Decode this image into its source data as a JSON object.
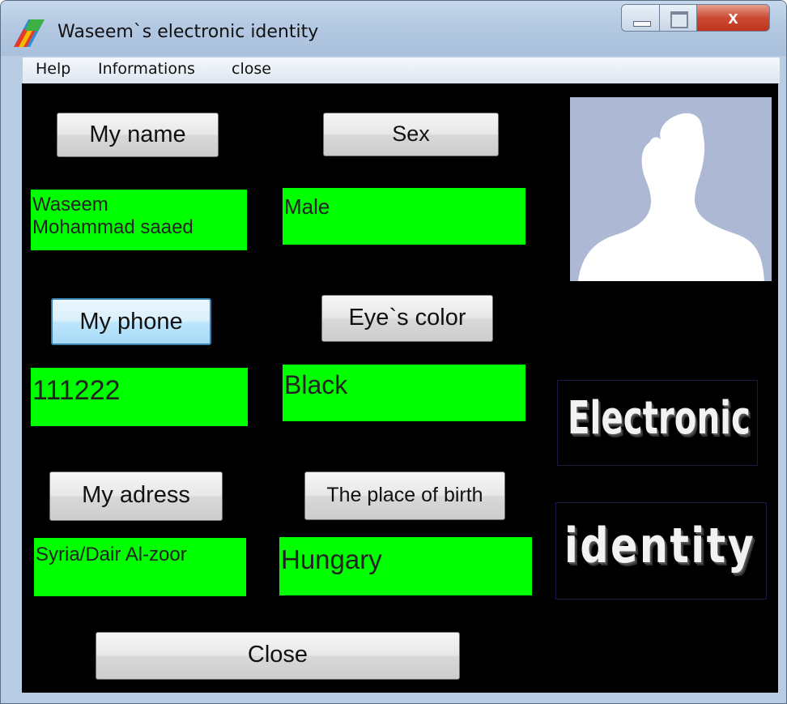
{
  "window": {
    "title": "Waseem`s electronic identity",
    "close_symbol": "x"
  },
  "menu": {
    "items": [
      "Help",
      "Informations",
      "close"
    ]
  },
  "fields": {
    "name": {
      "label": "My name",
      "value_line1": "Waseem",
      "value_line2": "Mohammad saaed"
    },
    "sex": {
      "label": "Sex",
      "value": "Male"
    },
    "phone": {
      "label": "My phone",
      "value": "111222"
    },
    "eye_color": {
      "label": "Eye`s color",
      "value": "Black"
    },
    "address": {
      "label": "My adress",
      "value": "Syria/Dair Al-zoor"
    },
    "birthplace": {
      "label": "The place of birth",
      "value": "Hungary"
    }
  },
  "close_button": {
    "label": "Close"
  },
  "logo": {
    "line1": "Electronic",
    "line2": "identity"
  },
  "colors": {
    "field_background": "#00ff00",
    "content_background": "#000000",
    "photo_background": "#adb8d5"
  },
  "icons": {
    "app": "app-logo-icon",
    "photo": "person-silhouette-icon"
  }
}
